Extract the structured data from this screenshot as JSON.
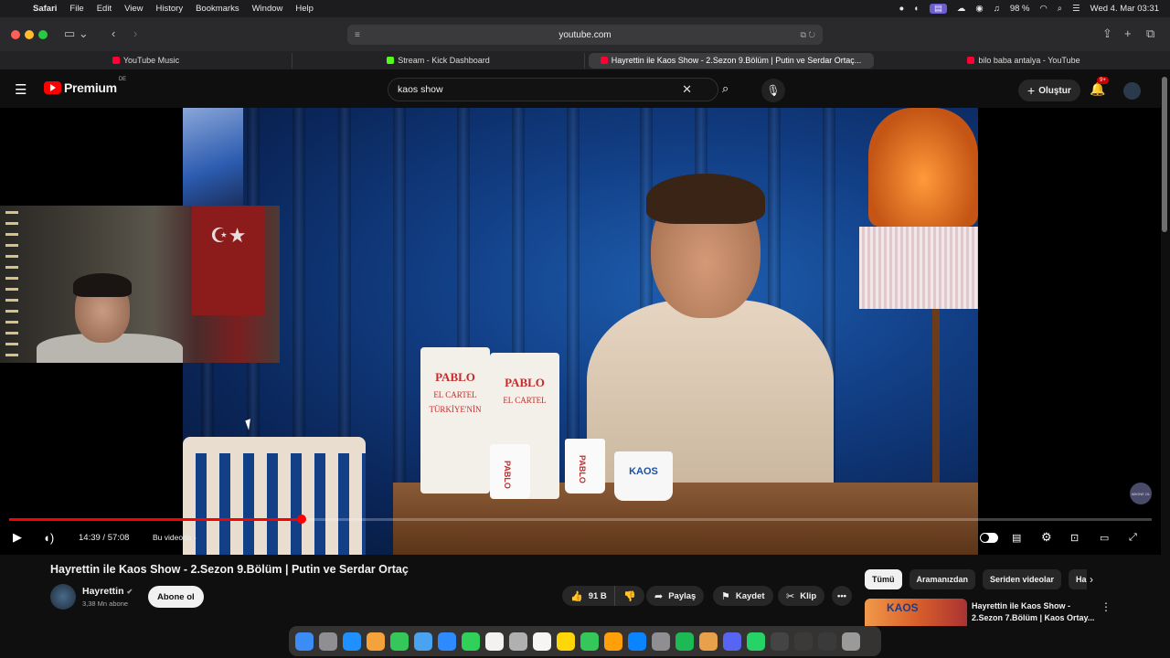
{
  "menubar": {
    "app": "Safari",
    "menus": [
      "File",
      "Edit",
      "View",
      "History",
      "Bookmarks",
      "Window",
      "Help"
    ],
    "battery": "98 %",
    "datetime": "Wed 4. Mar  03:31"
  },
  "browser": {
    "url": "youtube.com",
    "tabs": [
      {
        "label": "YouTube Music",
        "color": "#ff0033",
        "active": false
      },
      {
        "label": "Stream - Kick Dashboard",
        "color": "#53fc18",
        "active": false
      },
      {
        "label": "Hayrettin ile Kaos Show - 2.Sezon 9.Bölüm | Putin ve Serdar Ortaç...",
        "color": "#ff0033",
        "active": true
      },
      {
        "label": "bilo baba antalya - YouTube",
        "color": "#ff0033",
        "active": false
      }
    ]
  },
  "header": {
    "logo_text": "Premium",
    "region": "DE",
    "search_value": "kaos show",
    "create_label": "Oluştur",
    "notif_badge": "9+"
  },
  "video": {
    "bag_brand": "PABLO",
    "bag_sub": "EL CARTEL",
    "bag_sub2": "TÜRKİYE'NİN",
    "mug_text": "KAOS",
    "watermark": "ABONE OL",
    "time": "14:39 / 57:08",
    "chapter": "Bu videoda",
    "progress_fraction": 0.256
  },
  "meta": {
    "title": "Hayrettin ile Kaos Show - 2.Sezon 9.Bölüm | Putin ve Serdar Ortaç",
    "channel": "Hayrettin",
    "subscribers": "3,38 Mn abone",
    "subscribe_label": "Abone ol",
    "likes": "91 B",
    "share_label": "Paylaş",
    "save_label": "Kaydet",
    "clip_label": "Klip"
  },
  "sidebar": {
    "chips": [
      "Tümü",
      "Aramanızdan",
      "Seriden videolar",
      "Ha"
    ],
    "rec_thumb_text": "KAOS",
    "rec_title": "Hayrettin ile Kaos Show - 2.Sezon 7.Bölüm | Kaos Ortay..."
  },
  "colors": {
    "accent": "#ff0000",
    "brand": "#ff0000"
  }
}
